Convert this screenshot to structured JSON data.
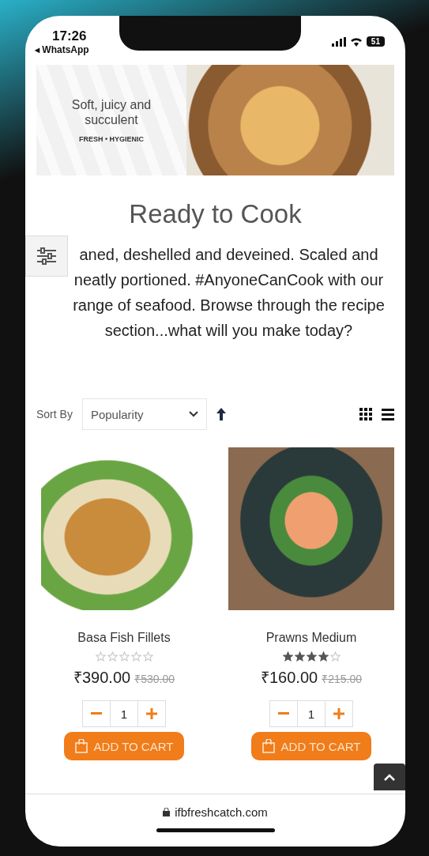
{
  "status_bar": {
    "time": "17:26",
    "back_app": "◂ WhatsApp",
    "battery": "51"
  },
  "banner": {
    "headline": "Soft, juicy and succulent",
    "tagline": "FRESH • HYGIENIC"
  },
  "page": {
    "title": "Ready to Cook",
    "description": "aned, deshelled and deveined. Scaled and neatly portioned. #AnyoneCanCook with our range of seafood. Browse through the recipe section...what will you make today?"
  },
  "sort": {
    "label": "Sort By",
    "value": "Popularity"
  },
  "products": [
    {
      "name": "Basa Fish Fillets",
      "stars": 0,
      "price": "₹390.00",
      "old_price": "₹530.00",
      "quantity": "1",
      "button": "ADD TO CART"
    },
    {
      "name": "Prawns Medium",
      "stars": 4,
      "price": "₹160.00",
      "old_price": "₹215.00",
      "quantity": "1",
      "button": "ADD TO CART"
    }
  ],
  "address_bar": {
    "url": "ifbfreshcatch.com"
  }
}
